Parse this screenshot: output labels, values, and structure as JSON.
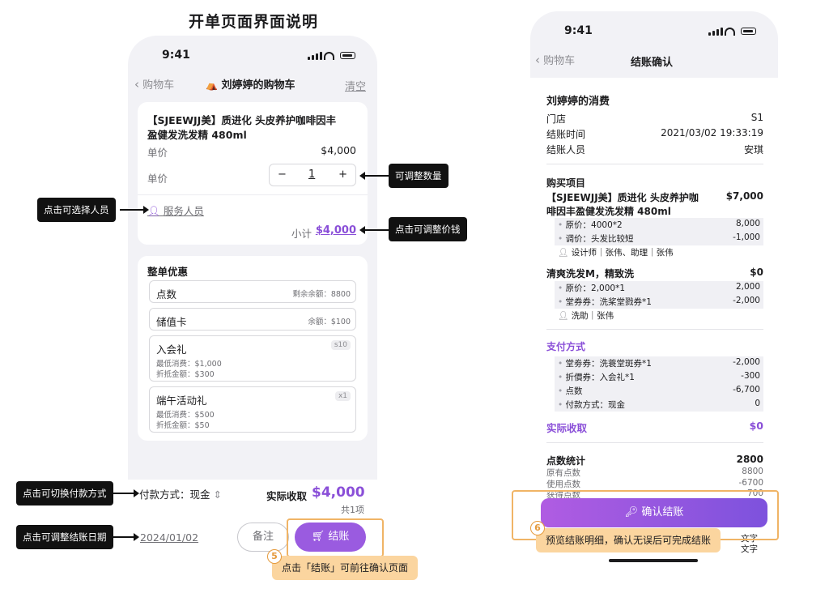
{
  "title": "开单页面界面说明",
  "left": {
    "time": "9:41",
    "back": "购物车",
    "nav_title": "刘婷婷的购物车",
    "clear": "清空",
    "product": {
      "name_line1": "【SJEEWJJ美】质进化 头皮养护咖啡因丰",
      "name_line2": "盈健发洗发精 480ml",
      "price_label": "单价",
      "price": "$4,000",
      "qty_label": "单价",
      "qty": "1",
      "staff": "服务人员",
      "subtotal_label": "小计",
      "subtotal": "$4,000"
    },
    "discounts": {
      "title": "整单优惠",
      "points": {
        "label": "点数",
        "info": "剩余余额：8800"
      },
      "card": {
        "label": "储值卡",
        "info": "余额：$100"
      },
      "gift1": {
        "label": "入会礼",
        "tag": "s10",
        "line1": "最低消费：$1,000",
        "line2": "折抵金额：$300"
      },
      "gift2": {
        "label": "端午活动礼",
        "tag": "x1",
        "line1": "最低消费：$500",
        "line2": "折抵金额：$50"
      }
    },
    "bottom": {
      "pay_label": "付款方式：现金",
      "actual_label": "实际收取",
      "actual": "$4,000",
      "count": "共1项",
      "date": "2024/01/02",
      "remark": "备注",
      "checkout": "结账"
    }
  },
  "annotations": {
    "qty": "可调整数量",
    "staff": "点击可选择人员",
    "price": "点击可调整价钱",
    "pay": "点击可切换付款方式",
    "date": "点击可调整结账日期",
    "step5_num": "5",
    "step5": "点击「结账」可前往确认页面",
    "step6_num": "6",
    "step6": "预览结账明细，确认无误后可完成结账"
  },
  "right": {
    "time": "9:41",
    "back": "购物车",
    "nav_title": "结账确认",
    "customer": "刘婷婷的消费",
    "store_label": "门店",
    "store": "S1",
    "time_label": "结账时间",
    "checkout_time": "2021/03/02 19:33:19",
    "staff_label": "结账人员",
    "staff": "安琪",
    "items_title": "购买项目",
    "item1_line1": "【SJEEWJJ美】质进化 头皮养护咖",
    "item1_line2": "啡因丰盈健发洗发精 480ml",
    "item1_price": "$7,000",
    "item1_sub1_l": "原价：4000*2",
    "item1_sub1_r": "8,000",
    "item1_sub2_l": "调价：头发比较短",
    "item1_sub2_r": "-1,000",
    "item1_staff": "设计师｜张伟、助理｜张伟",
    "item2": "清爽洗发M，精致洗",
    "item2_price": "$0",
    "item2_sub1_l": "原价：2,000*1",
    "item2_sub1_r": "2,000",
    "item2_sub2_l": "堂券券：洗桨堂戮券*1",
    "item2_sub2_r": "-2,000",
    "item2_staff": "洗助｜张伟",
    "pay_title": "支付方式",
    "pay1_l": "堂劵券：洗蓑堂斑券*1",
    "pay1_r": "-2,000",
    "pay2_l": "折價券：入会礼*1",
    "pay2_r": "-300",
    "pay3_l": "点数",
    "pay3_r": "-6,700",
    "pay4_l": "付款方式：现金",
    "pay4_r": "0",
    "actual_label": "实际收取",
    "actual": "$0",
    "points_title": "点数统计",
    "points_total": "2800",
    "p1_l": "原有点数",
    "p1_r": "8800",
    "p2_l": "使用点数",
    "p2_r": "-6700",
    "p3_l": "获得点数",
    "p3_r": "700",
    "confirm": "确认结账",
    "tail": "文字"
  },
  "colors": {
    "accent": "#8a4fd8",
    "orange": "#f0b466"
  }
}
